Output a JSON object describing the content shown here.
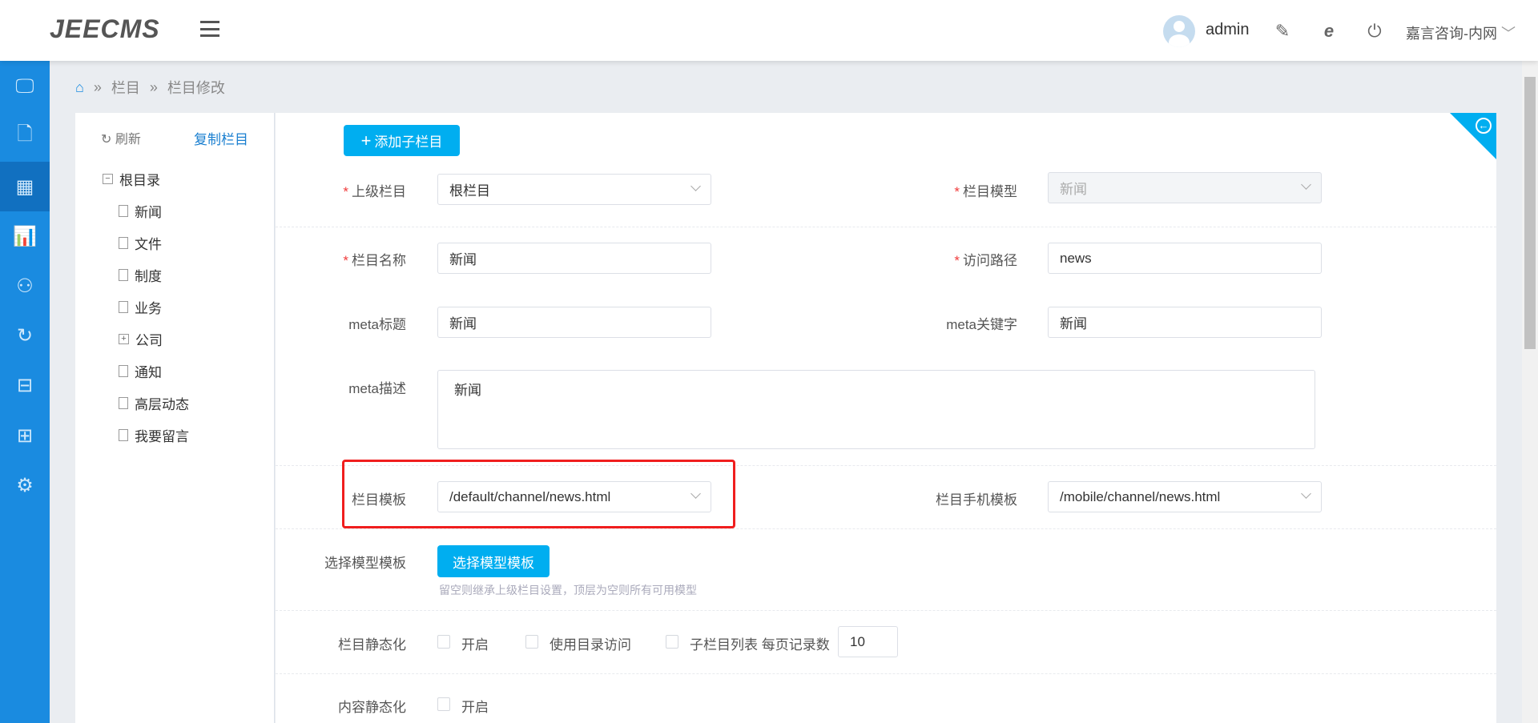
{
  "header": {
    "logo": "JEECMS",
    "user": "admin",
    "site": "嘉言咨询-内网",
    "icons": [
      "menu-icon",
      "user-edit-icon",
      "ie-browser-icon",
      "power-icon",
      "chevron-down-icon"
    ]
  },
  "sidebar": {
    "icons": [
      "monitor-icon",
      "file-icon",
      "grid-icon",
      "chart-icon",
      "user-icon",
      "refresh-circle-icon",
      "toolbox-icon",
      "windows-icon",
      "gear-icon"
    ],
    "active_index": 2
  },
  "breadcrumb": [
    "栏目",
    "栏目修改"
  ],
  "tree": {
    "refresh": "刷新",
    "copy": "复制栏目",
    "root": "根目录",
    "items": [
      {
        "label": "新闻",
        "type": "leaf"
      },
      {
        "label": "文件",
        "type": "leaf"
      },
      {
        "label": "制度",
        "type": "leaf"
      },
      {
        "label": "业务",
        "type": "leaf"
      },
      {
        "label": "公司",
        "type": "folder"
      },
      {
        "label": "通知",
        "type": "leaf"
      },
      {
        "label": "高层动态",
        "type": "leaf"
      },
      {
        "label": "我要留言",
        "type": "leaf"
      }
    ]
  },
  "form": {
    "add_child": "添加子栏目",
    "parent_label": "上级栏目",
    "parent_value": "根栏目",
    "model_label": "栏目模型",
    "model_value": "新闻",
    "name_label": "栏目名称",
    "name_value": "新闻",
    "path_label": "访问路径",
    "path_value": "news",
    "meta_title_label": "meta标题",
    "meta_title_value": "新闻",
    "meta_kw_label": "meta关键字",
    "meta_kw_value": "新闻",
    "meta_desc_label": "meta描述",
    "meta_desc_value": "新闻",
    "tpl_label": "栏目模板",
    "tpl_value": "/default/channel/news.html",
    "mobile_tpl_label": "栏目手机模板",
    "mobile_tpl_value": "/mobile/channel/news.html",
    "select_model_label": "选择模型模板",
    "select_model_button": "选择模型模板",
    "select_model_hint": "留空则继承上级栏目设置，顶层为空则所有可用模型",
    "static_label": "栏目静态化",
    "static_on": "开启",
    "use_dir": "使用目录访问",
    "sub_list": "子栏目列表 每页记录数",
    "page_size": "10",
    "content_static_label": "内容静态化",
    "content_static_on": "开启"
  }
}
